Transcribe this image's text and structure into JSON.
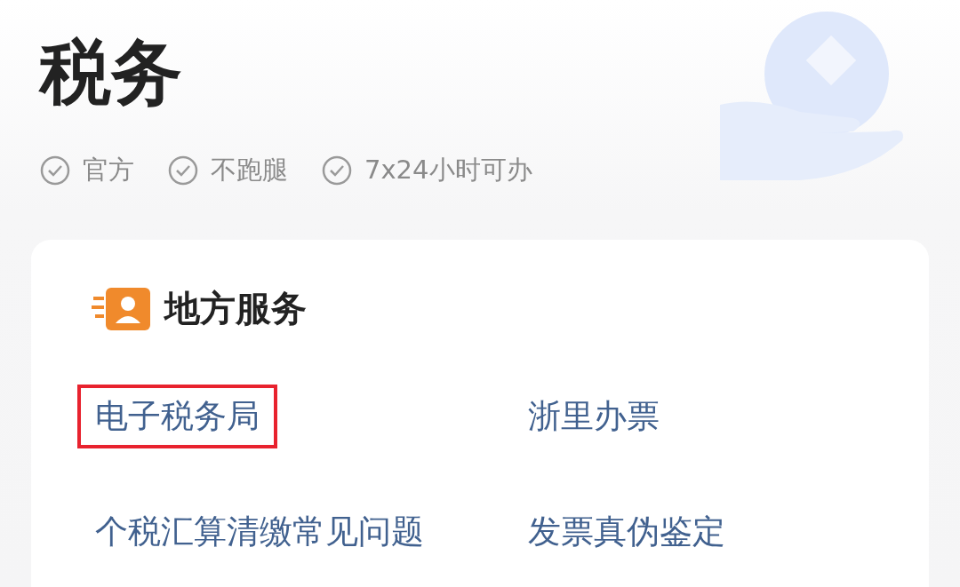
{
  "header": {
    "title": "税务",
    "features": [
      {
        "label": "官方"
      },
      {
        "label": "不跑腿"
      },
      {
        "label": "7x24小时可办"
      }
    ]
  },
  "card": {
    "title": "地方服务",
    "links": [
      {
        "label": "电子税务局",
        "highlighted": true
      },
      {
        "label": "浙里办票",
        "highlighted": false
      },
      {
        "label": "个税汇算清缴常见问题",
        "highlighted": false
      },
      {
        "label": "发票真伪鉴定",
        "highlighted": false
      }
    ]
  }
}
